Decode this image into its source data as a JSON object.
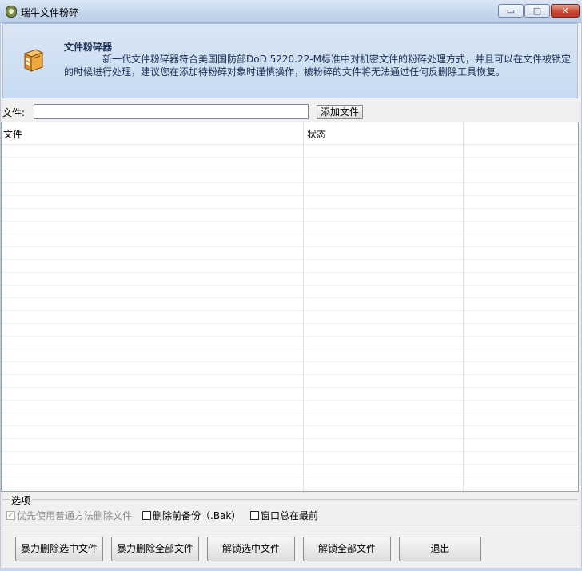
{
  "window": {
    "title": "瑞牛文件粉碎",
    "minimize_glyph": "▭",
    "maximize_glyph": "▢",
    "close_glyph": "✕"
  },
  "banner": {
    "title": "文件粉碎器",
    "description": "新一代文件粉碎器符合美国国防部DoD 5220.22-M标准中对机密文件的粉碎处理方式，并且可以在文件被锁定的时候进行处理，建议您在添加待粉碎对象时谨慎操作，被粉碎的文件将无法通过任何反删除工具恢复。",
    "icon": "shredder-box-icon"
  },
  "file_row": {
    "label": "文件:",
    "value": "",
    "add_button": "添加文件"
  },
  "list": {
    "columns": [
      "文件",
      "状态",
      ""
    ],
    "rows": []
  },
  "options": {
    "legend": "选项",
    "items": [
      {
        "label": "优先使用普通方法删除文件",
        "checked": true,
        "disabled": true
      },
      {
        "label": "删除前备份（.Bak）",
        "checked": false,
        "disabled": false
      },
      {
        "label": "窗口总在最前",
        "checked": false,
        "disabled": false
      }
    ]
  },
  "buttons": {
    "force_delete_selected": "暴力删除选中文件",
    "force_delete_all": "暴力删除全部文件",
    "unlock_selected": "解锁选中文件",
    "unlock_all": "解锁全部文件",
    "exit": "退出"
  }
}
